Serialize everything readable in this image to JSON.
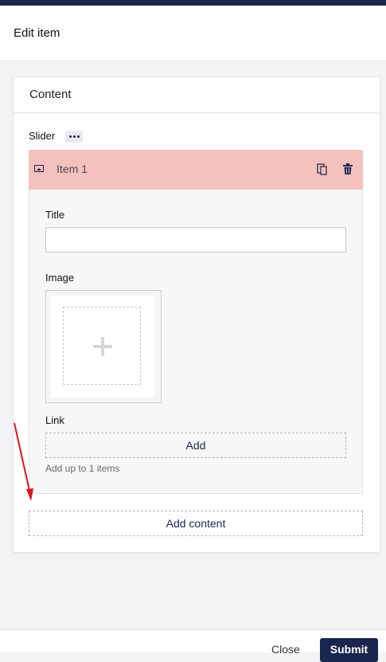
{
  "header": {
    "title": "Edit item"
  },
  "panel": {
    "title": "Content"
  },
  "slider": {
    "label": "Slider",
    "item": {
      "name": "Item 1"
    },
    "fields": {
      "title_label": "Title",
      "title_value": "",
      "image_label": "Image",
      "link_label": "Link",
      "link_add": "Add",
      "link_hint": "Add up to 1 items"
    }
  },
  "actions": {
    "add_content": "Add content"
  },
  "footer": {
    "close": "Close",
    "submit": "Submit"
  },
  "colors": {
    "navy": "#1b264f",
    "item_header_bg": "#f4c1bc",
    "annotation_arrow": "#e0141e"
  },
  "icons": [
    "more-icon",
    "image-icon",
    "copy-icon",
    "trash-icon",
    "plus-icon",
    "annotation-arrow"
  ]
}
